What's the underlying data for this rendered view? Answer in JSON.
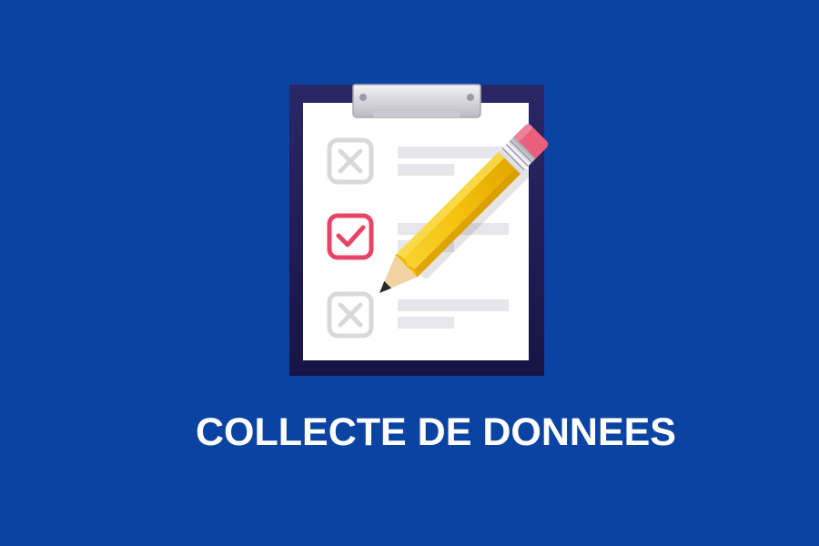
{
  "caption": "COLLECTE DE DONNEES",
  "colors": {
    "background": "#0b43a3",
    "board": "#231f52",
    "paper": "#ffffff",
    "checked_box": "#e84466",
    "unchecked_box": "#d9d9dc",
    "text_lines": "#e6e6eb",
    "pencil_body": "#f4c20d",
    "eraser": "#ea5f7c"
  },
  "checklist": {
    "items": [
      {
        "state": "unchecked",
        "icon": "x-box-icon"
      },
      {
        "state": "checked",
        "icon": "check-box-icon"
      },
      {
        "state": "unchecked",
        "icon": "x-box-icon"
      }
    ]
  },
  "icons": {
    "clipboard": "clipboard-icon",
    "pencil": "pencil-icon"
  }
}
